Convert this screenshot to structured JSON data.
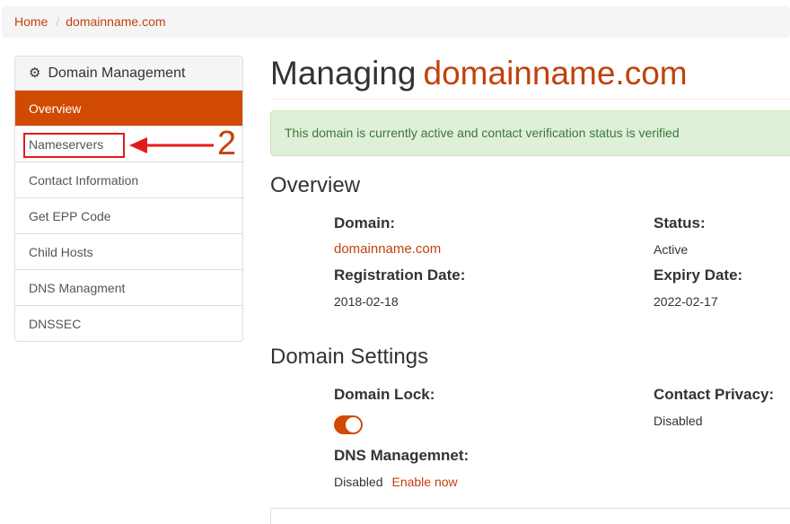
{
  "breadcrumb": {
    "home": "Home",
    "separator": "/",
    "current": "domainname.com"
  },
  "sidebar": {
    "heading": "Domain Management",
    "heading_icon": "gear-icon",
    "items": [
      {
        "label": "Overview",
        "active": true
      },
      {
        "label": "Nameservers"
      },
      {
        "label": "Contact Information"
      },
      {
        "label": "Get EPP Code"
      },
      {
        "label": "Child Hosts"
      },
      {
        "label": "DNS Managment"
      },
      {
        "label": "DNSSEC"
      }
    ]
  },
  "annotation": {
    "step_number": "2",
    "color": "#e31b1b"
  },
  "page": {
    "title_prefix": "Managing",
    "title_domain": "domainname.com"
  },
  "alert": {
    "text": "This domain is currently active and contact verification status is verified"
  },
  "overview": {
    "heading": "Overview",
    "domain_label": "Domain:",
    "domain_value": "domainname.com",
    "status_label": "Status:",
    "status_value": "Active",
    "registration_label": "Registration Date:",
    "registration_value": "2018-02-18",
    "expiry_label": "Expiry Date:",
    "expiry_value": "2022-02-17"
  },
  "settings": {
    "heading": "Domain Settings",
    "lock_label": "Domain Lock:",
    "lock_enabled": true,
    "privacy_label": "Contact Privacy:",
    "privacy_value": "Disabled",
    "dns_label": "DNS Managemnet:",
    "dns_value": "Disabled",
    "dns_enable_link": "Enable now"
  },
  "colors": {
    "accent": "#d04a02",
    "link": "#c2410c",
    "success_bg": "#dff0d8",
    "success_text": "#3c763d"
  }
}
